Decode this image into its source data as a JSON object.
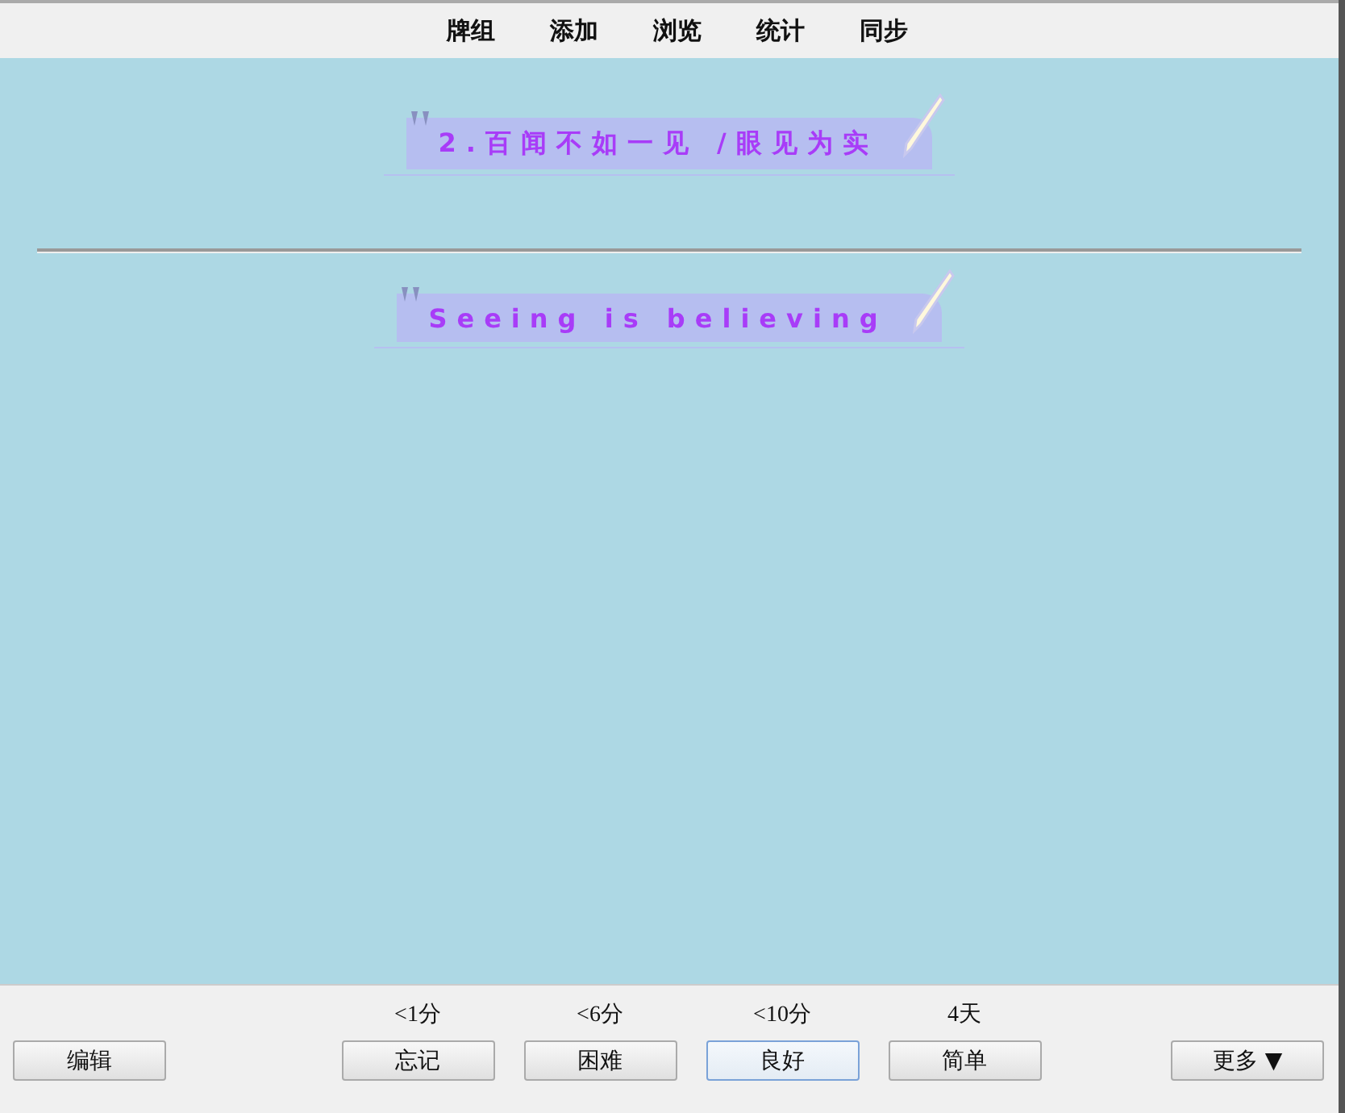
{
  "menu": [
    {
      "label": "牌组"
    },
    {
      "label": "添加"
    },
    {
      "label": "浏览"
    },
    {
      "label": "统计"
    },
    {
      "label": "同步"
    }
  ],
  "card": {
    "front": "2.百闻不如一见 /眼见为实",
    "back": "Seeing is believing"
  },
  "edit_button": "编辑",
  "answers": [
    {
      "interval": "<1分",
      "label": "忘记",
      "selected": false
    },
    {
      "interval": "<6分",
      "label": "困难",
      "selected": false
    },
    {
      "interval": "<10分",
      "label": "良好",
      "selected": true
    },
    {
      "interval": "4天",
      "label": "简单",
      "selected": false
    }
  ],
  "more_button": "更多 ▼"
}
